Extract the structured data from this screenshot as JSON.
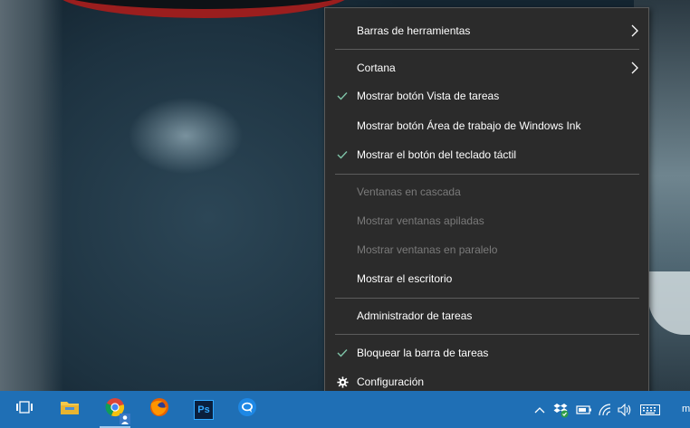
{
  "context_menu": {
    "items": [
      {
        "label": "Barras de herramientas",
        "checked": false,
        "submenu": true,
        "disabled": false
      },
      {
        "label": "Cortana",
        "checked": false,
        "submenu": true,
        "disabled": false
      },
      {
        "label": "Mostrar botón Vista de tareas",
        "checked": true,
        "submenu": false,
        "disabled": false
      },
      {
        "label": "Mostrar botón Área de trabajo de Windows Ink",
        "checked": false,
        "submenu": false,
        "disabled": false
      },
      {
        "label": "Mostrar el botón del teclado táctil",
        "checked": true,
        "submenu": false,
        "disabled": false
      },
      {
        "label": "Ventanas en cascada",
        "checked": false,
        "submenu": false,
        "disabled": true
      },
      {
        "label": "Mostrar ventanas apiladas",
        "checked": false,
        "submenu": false,
        "disabled": true
      },
      {
        "label": "Mostrar ventanas en paralelo",
        "checked": false,
        "submenu": false,
        "disabled": true
      },
      {
        "label": "Mostrar el escritorio",
        "checked": false,
        "submenu": false,
        "disabled": false
      },
      {
        "label": "Administrador de tareas",
        "checked": false,
        "submenu": false,
        "disabled": false
      },
      {
        "label": "Bloquear la barra de tareas",
        "checked": true,
        "submenu": false,
        "disabled": false
      },
      {
        "label": "Configuración",
        "icon": "gear-icon",
        "submenu": false,
        "disabled": false
      }
    ]
  },
  "taskbar": {
    "apps": [
      {
        "name": "task-view-icon"
      },
      {
        "name": "file-explorer-icon"
      },
      {
        "name": "chrome-icon"
      },
      {
        "name": "firefox-icon"
      },
      {
        "name": "photoshop-icon",
        "text": "Ps"
      },
      {
        "name": "chat-app-icon"
      }
    ],
    "tray_overflow_text": "m"
  },
  "colors": {
    "menu_bg": "#2b2b2b",
    "check": "#7fc4a8",
    "taskbar": "#1f6fb5"
  }
}
